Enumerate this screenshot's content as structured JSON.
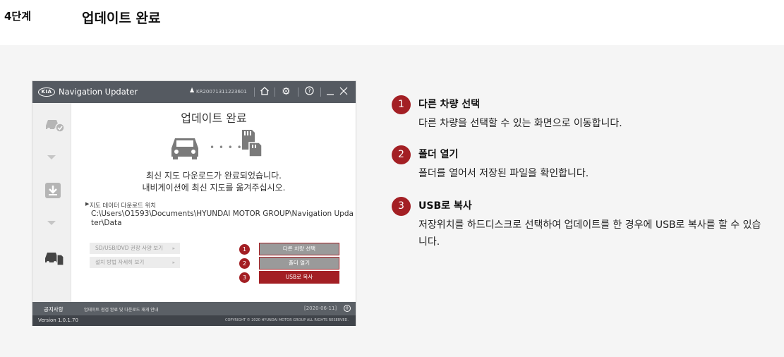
{
  "header": {
    "step": "4단계",
    "title": "업데이트 완료"
  },
  "app": {
    "name": "Navigation Updater",
    "logo_text": "KIA",
    "user_id": "KR20071311223601",
    "main_title": "업데이트 완료",
    "message_line1": "최신 지도 다운로드가 완료되었습니다.",
    "message_line2": "내비게이션에 최신 지도를 옮겨주십시오.",
    "location_label": "지도 데이터 다운로드 위치",
    "location_path": "C:\\Users\\O1593\\Documents\\HYUNDAI MOTOR GROUP\\Navigation Updater\\Data",
    "ghost_buttons": [
      "SD/USB/DVD 권장 사양 보기",
      "설치 방법 자세히 보기"
    ],
    "actions": [
      {
        "num": "1",
        "label": "다른 차량 선택"
      },
      {
        "num": "2",
        "label": "폴더 열기"
      },
      {
        "num": "3",
        "label": "USB로 복사"
      }
    ],
    "notice_label": "공지사항",
    "notice_text": "업데이트 점검 완료 및 다운로드 재개 안내",
    "notice_date": "[2020-06-11]",
    "version": "Version 1.0.1.70",
    "copyright": "COPYRIGHT © 2020 HYUNDAI MOTOR GROUP ALL RIGHTS RESERVED."
  },
  "legend": [
    {
      "num": "1",
      "title": "다른 차량 선택",
      "desc": "다른 차량을 선택할 수 있는 화면으로 이동합니다."
    },
    {
      "num": "2",
      "title": "폴더 열기",
      "desc": "폴더를 열어서 저장된 파일을 확인합니다."
    },
    {
      "num": "3",
      "title": "USB로 복사",
      "desc": "저장위치를 하드디스크로 선택하여 업데이트를 한 경우에 USB로 복사를 할 수 있습니다."
    }
  ],
  "icons": {
    "home": "home-icon",
    "settings": "gear-icon",
    "help": "help-icon",
    "minimize": "minimize-icon",
    "close": "close-icon",
    "user": "user-icon"
  },
  "colors": {
    "accent": "#a31f24",
    "titlebar": "#555a61",
    "panel": "#f5f5f5"
  }
}
